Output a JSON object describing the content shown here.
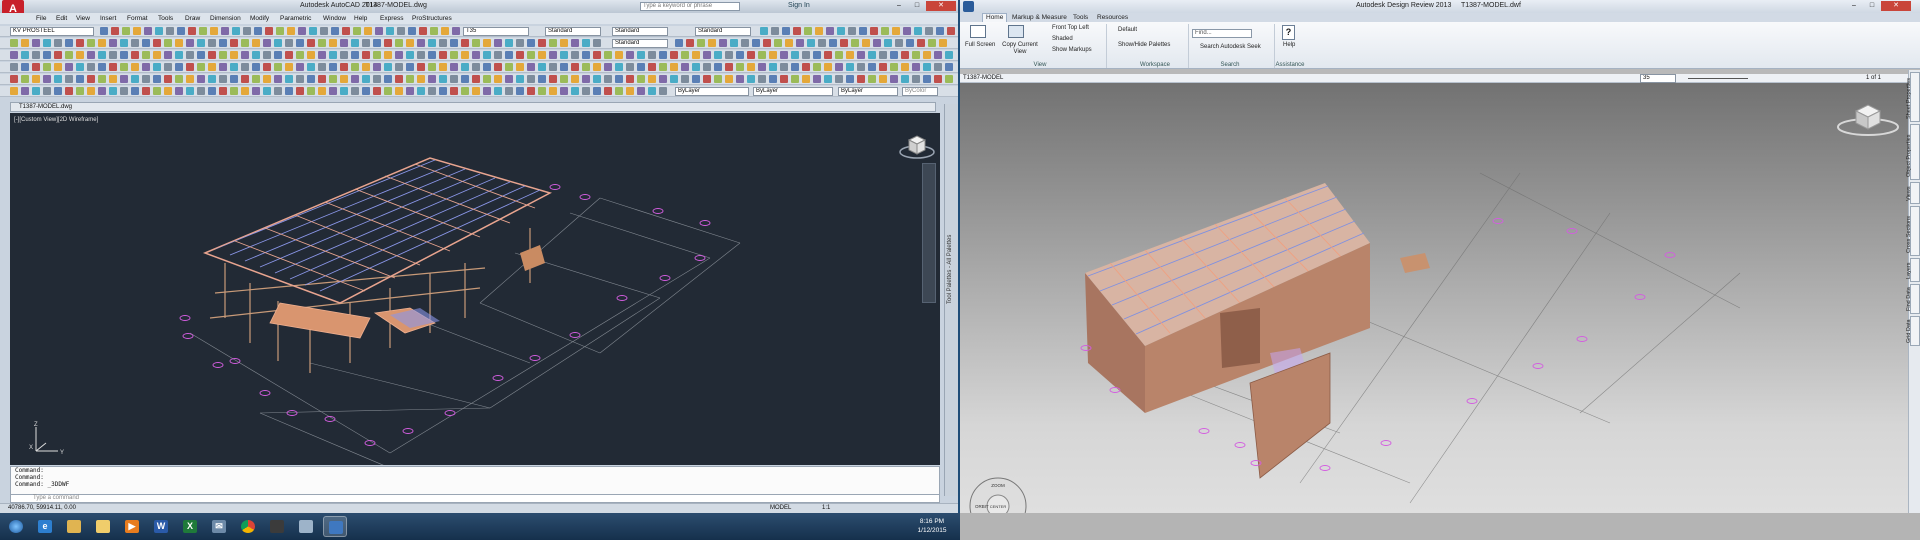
{
  "autocad": {
    "window_title": "Autodesk AutoCAD 2014",
    "file_title": "T1387-MODEL.dwg",
    "search_placeholder": "Type a keyword or phrase",
    "sign_in": "Sign In",
    "menus": [
      "File",
      "Edit",
      "View",
      "Insert",
      "Format",
      "Tools",
      "Draw",
      "Dimension",
      "Modify",
      "Parametric",
      "Window",
      "Help",
      "Express",
      "ProStructures"
    ],
    "workspace": "KV PROSTEEL",
    "text_style": "T35",
    "dim_style": "Standard",
    "table_style": "Standard",
    "mleader_style": "Standard",
    "ml_style": "Standard",
    "layer_color": "ByLayer",
    "layer_linetype": "ByLayer",
    "layer_lineweight": "ByLayer",
    "plot_style": "ByColor",
    "drawing_tab": "T1387-MODEL.dwg",
    "viewport_label": "[-][Custom View][2D Wireframe]",
    "palette_label": "Tool Palettes - All Palettes",
    "command_lines": [
      "Command:",
      "Command:",
      "Command: _3DDWF"
    ],
    "command_placeholder": "Type a command",
    "coords": "40786.70, 59914.11, 0.00",
    "model_tab": "MODEL",
    "scale": "1:1",
    "ucs_x": "X",
    "ucs_y": "Y",
    "ucs_z": "Z"
  },
  "design_review": {
    "window_title": "Autodesk Design Review 2013",
    "file_title": "T1387-MODEL.dwf",
    "tabs": [
      "Home",
      "Markup & Measure",
      "Tools",
      "Resources"
    ],
    "ribbon": {
      "full_screen": "Full Screen",
      "copy_current_view": "Copy Current View",
      "front_top_left": "Front Top Left",
      "shaded": "Shaded",
      "show_markups": "Show Markups",
      "default": "Default",
      "show_hide_palettes": "Show/Hide Palettes",
      "find_placeholder": "Find...",
      "search_seek": "Search Autodesk Seek",
      "help": "Help",
      "group_view": "View",
      "group_workspace": "Workspace",
      "group_search": "Search",
      "group_assistance": "Assistance"
    },
    "sheet_name": "T1387-MODEL",
    "zoom_value": "35",
    "page_counter": "1 of 1",
    "side_tabs": [
      "Sheet Properties",
      "Object Properties",
      "Views",
      "Cross Sections",
      "Layers",
      "Find Data",
      "Grid Data"
    ],
    "steering": {
      "zoom": "ZOOM",
      "orbit": "ORBIT",
      "pan": "PAN",
      "center": "CENTER"
    }
  },
  "taskbar": {
    "apps": [
      "start-orb",
      "internet-explorer",
      "windows-explorer",
      "file-folder",
      "media-player",
      "word",
      "excel",
      "outlook-mail",
      "chrome",
      "autocad",
      "recycle-bin",
      "design-review"
    ],
    "time": "8:16 PM",
    "date": "1/12/2015"
  },
  "colors": {
    "autocad_viewport": "#222a35",
    "frame_steel": "#e8a48f",
    "roof_purgin": "#8a96e8",
    "grid_marker": "#d35de0",
    "model_wall": "#b9846a"
  }
}
